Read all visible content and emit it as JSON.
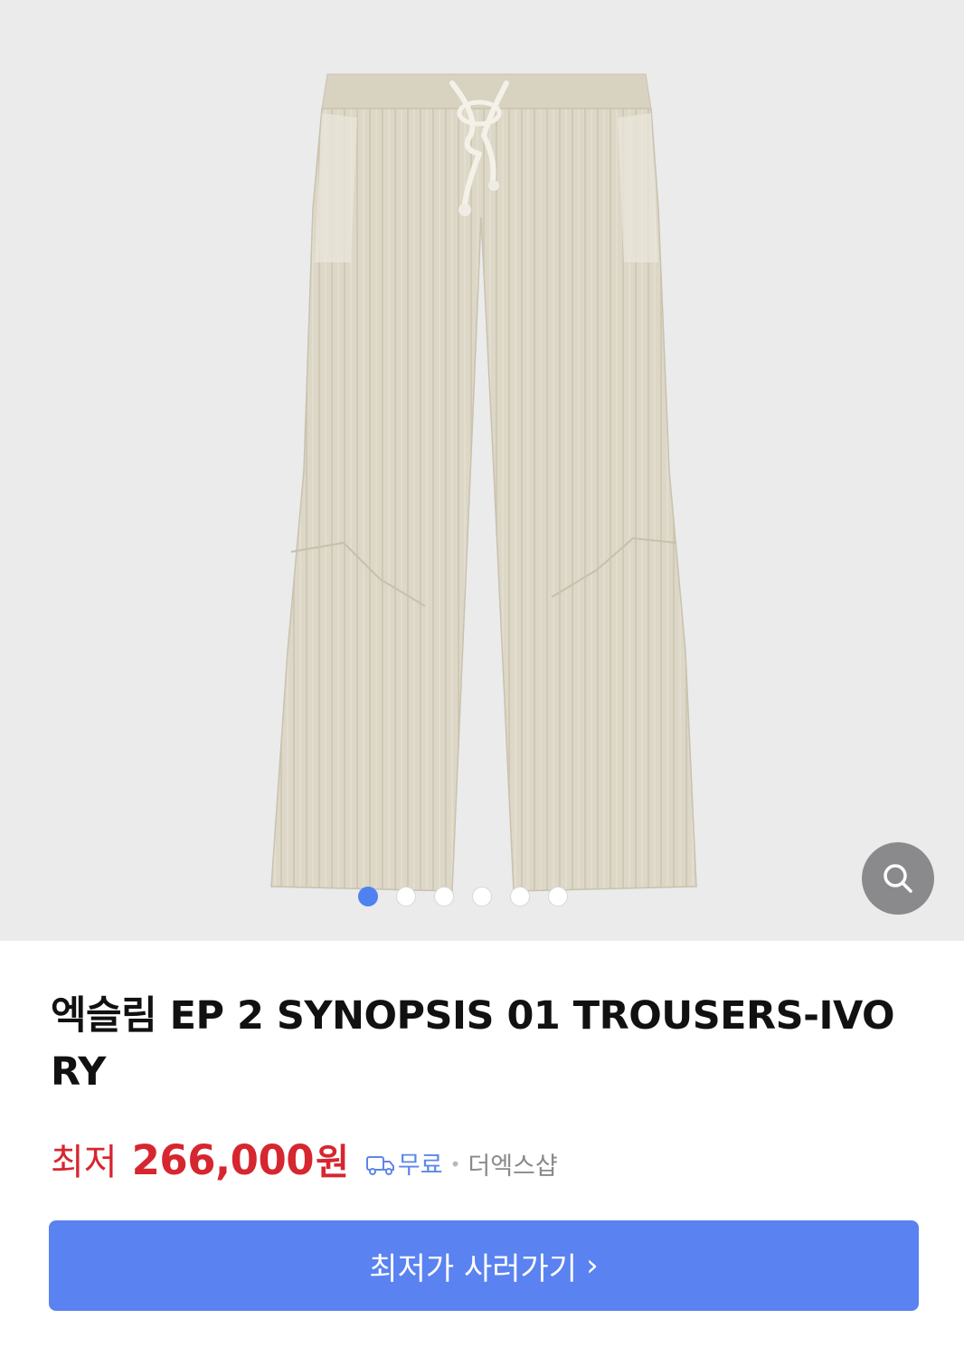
{
  "product": {
    "title": "엑슬림 EP 2 SYNOPSIS 01 TROUSERS-IVORY",
    "image_icon": "trousers-product-image",
    "carousel_count": 6,
    "carousel_active_index": 0
  },
  "price": {
    "label": "최저",
    "value": "266,000",
    "unit": "원"
  },
  "shipping": {
    "icon": "delivery-truck-icon",
    "label": "무료"
  },
  "separator": "•",
  "seller": "더엑스샵",
  "cta": {
    "label": "최저가 사러가기",
    "chevron": "›"
  },
  "zoom": {
    "icon": "search-icon"
  },
  "colors": {
    "price_red": "#d6262f",
    "accent_blue": "#5a82f0",
    "hero_bg": "#ebebec",
    "fabric": "#dcd7c6"
  }
}
